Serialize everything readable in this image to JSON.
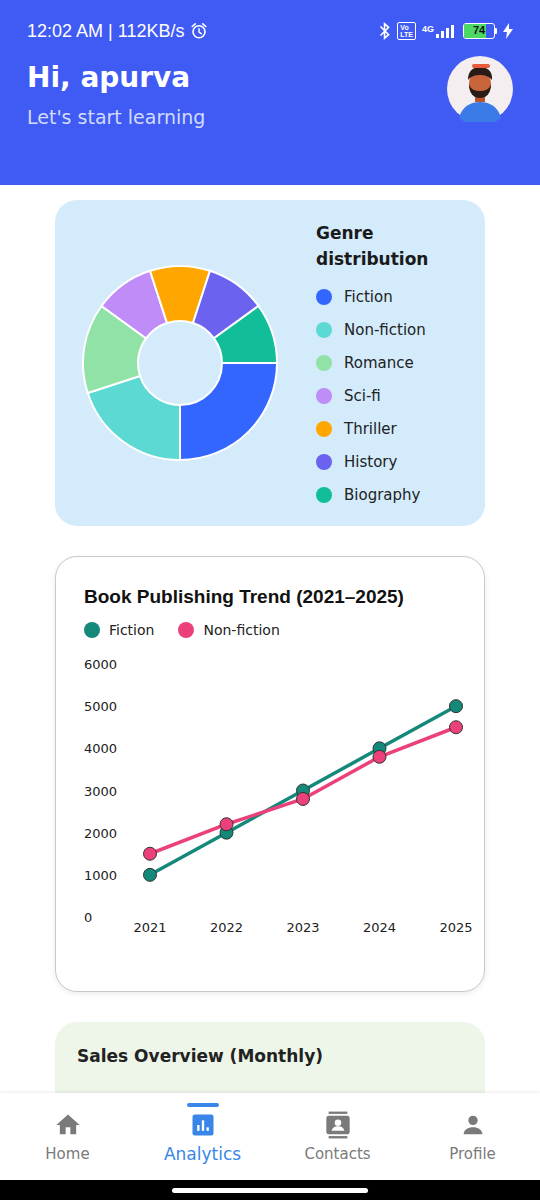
{
  "status_bar": {
    "time": "12:02 AM | 112KB/s",
    "volte_top": "Vo",
    "volte_bottom": "LTE",
    "network": "4G",
    "battery": "74",
    "battery_level": 0.74,
    "charging": true
  },
  "header": {
    "greeting": "Hi, apurva",
    "subtitle": "Let's start learning"
  },
  "genre_chart": {
    "title": "Genre distribution",
    "items": [
      {
        "label": "Fiction",
        "value": 25,
        "color": "#3366ff"
      },
      {
        "label": "Non-fiction",
        "value": 20,
        "color": "#5dd9d4"
      },
      {
        "label": "Romance",
        "value": 15,
        "color": "#90e2a6"
      },
      {
        "label": "Sci-fi",
        "value": 10,
        "color": "#c08cf7"
      },
      {
        "label": "Thriller",
        "value": 10,
        "color": "#ffa600"
      },
      {
        "label": "History",
        "value": 10,
        "color": "#6b63f0"
      },
      {
        "label": "Biography",
        "value": 10,
        "color": "#12bd9a"
      }
    ]
  },
  "trend_chart": {
    "title": "Book Publishing Trend (2021–2025)",
    "y_ticks": [
      "6000",
      "5000",
      "4000",
      "3000",
      "2000",
      "1000",
      "0"
    ],
    "x_labels": [
      "2021",
      "2022",
      "2023",
      "2024",
      "2025"
    ],
    "series": [
      {
        "name": "Fiction",
        "color": "#14897a",
        "values": [
          1000,
          2000,
          3000,
          4000,
          5000
        ]
      },
      {
        "name": "Non-fiction",
        "color": "#ec407a",
        "values": [
          1500,
          2200,
          2800,
          3800,
          4500
        ]
      }
    ]
  },
  "sales_card": {
    "title": "Sales Overview (Monthly)"
  },
  "nav": {
    "items": [
      {
        "label": "Home",
        "selected": false
      },
      {
        "label": "Analytics",
        "selected": true
      },
      {
        "label": "Contacts",
        "selected": false
      },
      {
        "label": "Profile",
        "selected": false
      }
    ]
  }
}
